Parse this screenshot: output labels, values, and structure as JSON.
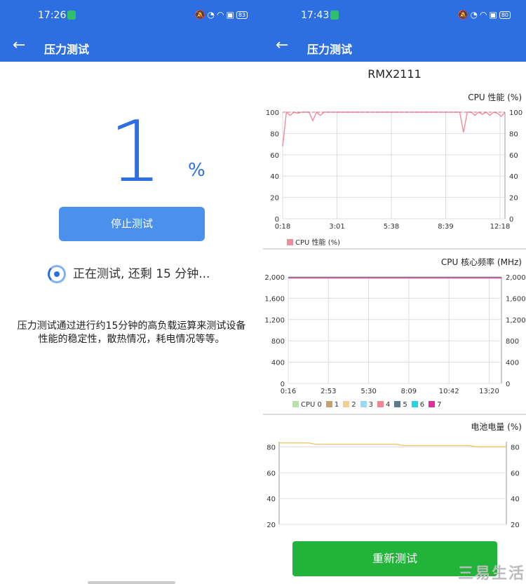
{
  "left": {
    "status": {
      "time": "17:26",
      "battery": "83"
    },
    "appbar": {
      "title": "压力测试"
    },
    "progress_value": "1",
    "progress_unit": "%",
    "stop_button": "停止测试",
    "running_text": "正在测试, 还剩 15 分钟...",
    "description": "压力测试通过进行约15分钟的高负载运算来测试设备性能的稳定性，散热情况，耗电情况等等。"
  },
  "right": {
    "status": {
      "time": "17:43",
      "battery": "80"
    },
    "appbar": {
      "title": "压力测试"
    },
    "model": "RMX2111",
    "retest_button": "重新测试",
    "watermark": "三易生活"
  },
  "colors": {
    "primary": "#2d6fe0",
    "stop_button": "#4b91ec",
    "retest_button": "#21b33a"
  },
  "chart_data": [
    {
      "type": "line",
      "title": "CPU 性能 (%)",
      "x": [
        "0:18",
        "3:01",
        "5:38",
        "8:39",
        "12:18"
      ],
      "ylim": [
        0,
        100
      ],
      "yticks": [
        "0",
        "20",
        "40",
        "60",
        "80",
        "100"
      ],
      "series": [
        {
          "name": "CPU 性能 (%)",
          "color": "#f08c9c",
          "values": [
            68,
            100,
            97,
            100,
            99,
            100,
            100,
            100,
            92,
            100,
            97,
            100,
            100,
            100,
            100,
            100,
            100,
            100,
            100,
            100,
            100,
            100,
            100,
            100,
            100,
            100,
            100,
            100,
            100,
            100,
            100,
            100,
            100,
            100,
            100,
            100,
            100,
            100,
            100,
            100,
            100,
            100,
            100,
            100,
            100,
            100,
            100,
            100,
            81,
            100,
            100,
            97,
            100,
            98,
            100,
            97,
            100,
            99,
            96,
            100
          ]
        }
      ]
    },
    {
      "type": "line",
      "title": "CPU 核心频率 (MHz)",
      "x": [
        "0:16",
        "2:53",
        "5:30",
        "8:09",
        "10:42",
        "13:20"
      ],
      "ylim": [
        0,
        2000
      ],
      "yticks": [
        "0",
        "400",
        "800",
        "1,200",
        "1,600",
        "2,000"
      ],
      "series": [
        {
          "name": "CPU 0",
          "color": "#b6e3a8",
          "value": 2000
        },
        {
          "name": "1",
          "color": "#c5a26b",
          "value": 2000
        },
        {
          "name": "2",
          "color": "#f5cf8a",
          "value": 2000
        },
        {
          "name": "3",
          "color": "#9ad9ef",
          "value": 2000
        },
        {
          "name": "4",
          "color": "#f0869a",
          "value": 2000
        },
        {
          "name": "5",
          "color": "#5d7a8c",
          "value": 2000
        },
        {
          "name": "6",
          "color": "#21d4e6",
          "value": 2000
        },
        {
          "name": "7",
          "color": "#e02e9b",
          "value": 2000
        }
      ]
    },
    {
      "type": "line",
      "title": "电池电量 (%)",
      "ylim": [
        20,
        84
      ],
      "yticks": [
        "20",
        "40",
        "60",
        "80"
      ],
      "series": [
        {
          "name": "电池电量",
          "color": "#f2c56a",
          "values": [
            83,
            83,
            83,
            83,
            83,
            82,
            82,
            82,
            82,
            82,
            82,
            82,
            82,
            82,
            82,
            82,
            82,
            81,
            81,
            81,
            81,
            81,
            81,
            81,
            81,
            81,
            81,
            80,
            80,
            80,
            80,
            80
          ]
        }
      ]
    }
  ]
}
